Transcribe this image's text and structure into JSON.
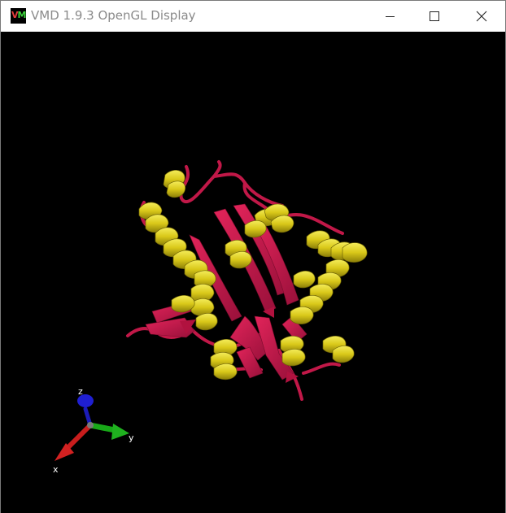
{
  "window": {
    "title": "VMD 1.9.3 OpenGL Display",
    "icon_name": "vmd-app-icon",
    "buttons": [
      "minimize-icon",
      "maximize-icon",
      "close-icon"
    ]
  },
  "display": {
    "background_color": "#000000",
    "molecule_render": "cartoon",
    "colors": {
      "helix": "#e3d21f",
      "sheet_and_coil": "#c9174a"
    },
    "axes": {
      "x_label": "x",
      "y_label": "y",
      "z_label": "z",
      "x_color": "#d11f1f",
      "y_color": "#1fb11f",
      "z_color": "#1f1fd1"
    }
  }
}
